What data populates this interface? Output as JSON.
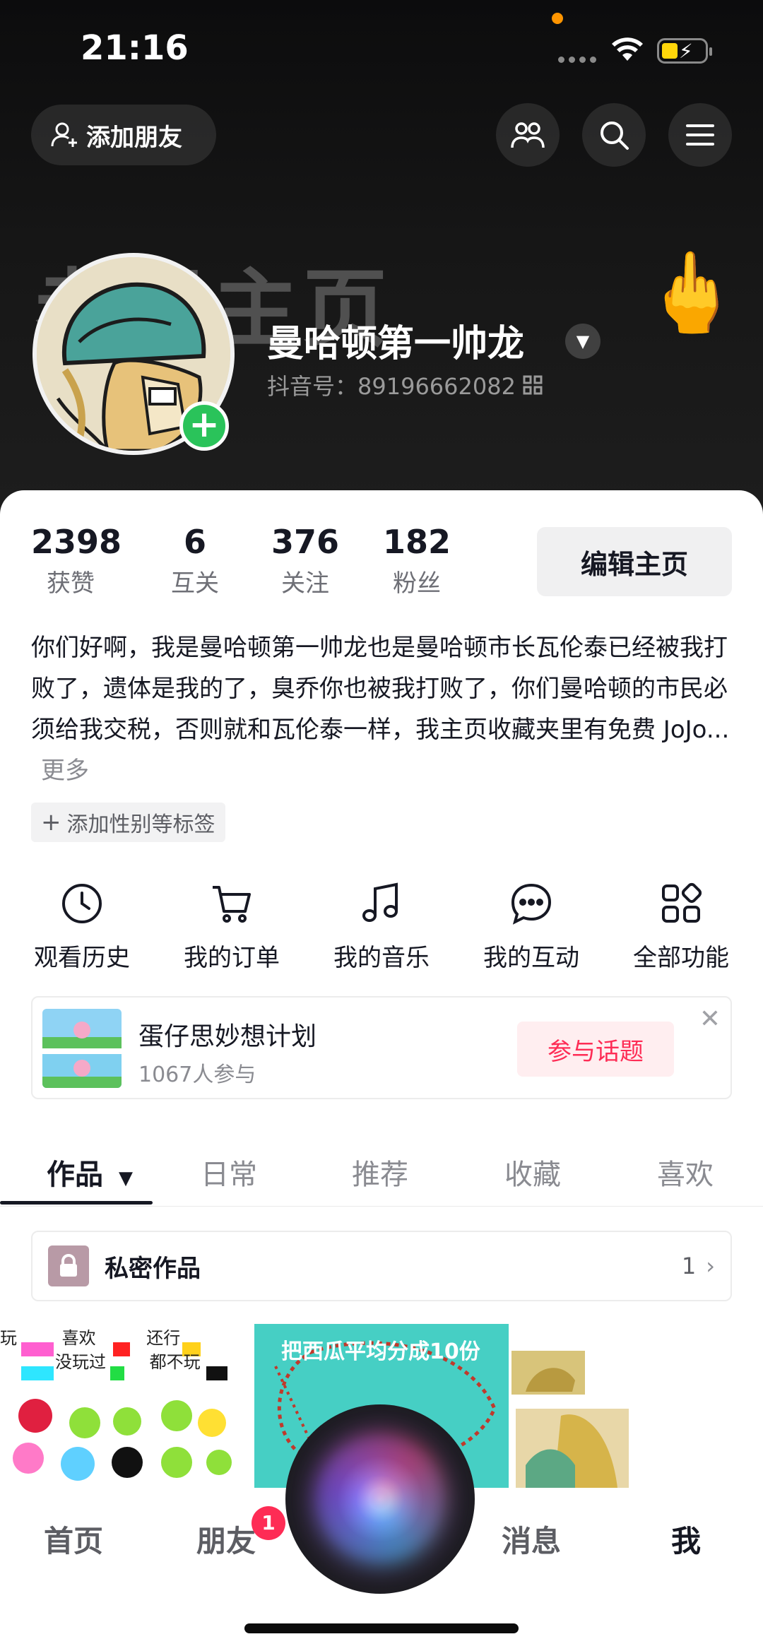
{
  "status_bar": {
    "time": "21:16"
  },
  "header": {
    "add_friend_label": "添加朋友",
    "banner_text": "老母主页",
    "nickname": "曼哈顿第一帅龙",
    "douyin_id": "抖音号：89196662082"
  },
  "stats": [
    {
      "value": "2398",
      "label": "获赞"
    },
    {
      "value": "6",
      "label": "互关"
    },
    {
      "value": "376",
      "label": "关注"
    },
    {
      "value": "182",
      "label": "粉丝"
    }
  ],
  "edit_profile_label": "编辑主页",
  "bio": {
    "text": "你们好啊，我是曼哈顿第一帅龙也是曼哈顿市长瓦伦泰已经被我打败了，遗体是我的了，臭乔你也被我打败了，你们曼哈顿的市民必须给我交税，否则就和瓦伦泰一样，我主页收藏夹里有免费 JoJo...",
    "more": "更多"
  },
  "add_tag_label": "添加性别等标签",
  "shortcuts": [
    {
      "label": "观看历史",
      "icon": "clock-icon"
    },
    {
      "label": "我的订单",
      "icon": "cart-icon"
    },
    {
      "label": "我的音乐",
      "icon": "music-note-icon"
    },
    {
      "label": "我的互动",
      "icon": "chat-bubble-icon"
    },
    {
      "label": "全部功能",
      "icon": "apps-grid-icon"
    }
  ],
  "topic": {
    "title": "蛋仔思妙想计划",
    "participants": "1067人参与",
    "join_label": "参与话题"
  },
  "tabs": [
    {
      "label": "作品",
      "active": true
    },
    {
      "label": "日常"
    },
    {
      "label": "推荐"
    },
    {
      "label": "收藏"
    },
    {
      "label": "喜欢"
    }
  ],
  "private_works": {
    "label": "私密作品",
    "count": "1"
  },
  "grid": {
    "item1_rows": [
      "玩",
      "喜欢",
      "还行",
      "没玩过",
      "都不玩"
    ],
    "item2_caption": "把西瓜平均分成10份"
  },
  "bottom_nav": {
    "items": [
      {
        "label": "首页"
      },
      {
        "label": "朋友"
      },
      {
        "label": "消息"
      },
      {
        "label": "我",
        "active": true
      }
    ],
    "friends_badge": "1"
  },
  "colors": {
    "accent": "#fe2c55",
    "plus_green": "#2ac35a",
    "text_primary": "#161823",
    "text_secondary": "#8a8b91"
  }
}
